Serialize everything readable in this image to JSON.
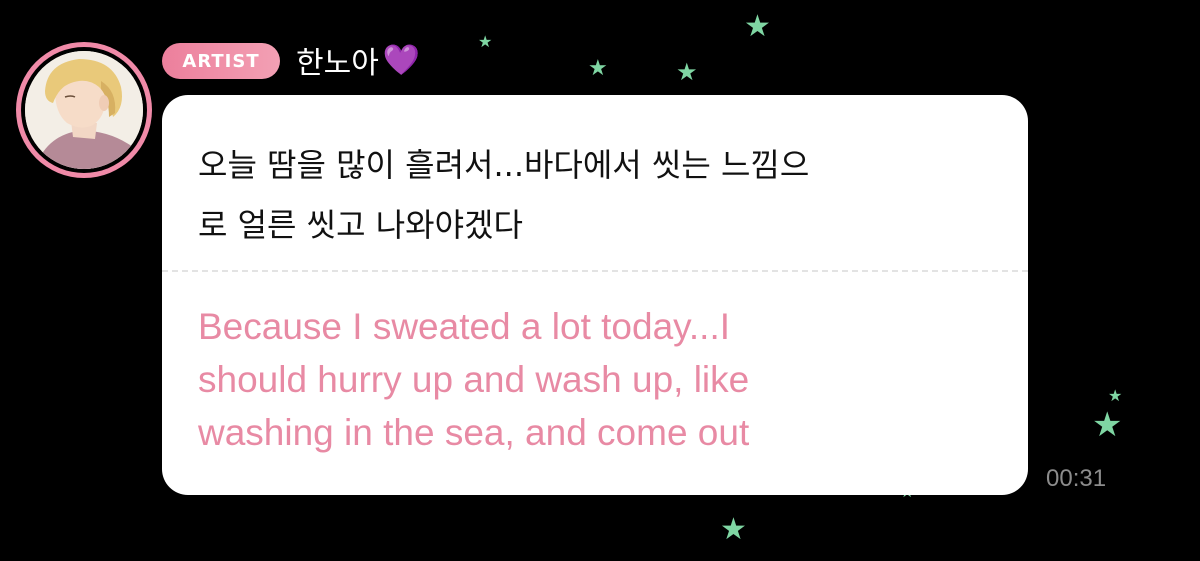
{
  "badge": {
    "label": "ARTIST"
  },
  "sender": {
    "name": "한노아",
    "heart": "💜"
  },
  "message": {
    "original_line1": "오늘 땀을 많이 흘려서...바다에서 씻는 느낌으",
    "original_line2": "로 얼른 씻고 나와야겠다",
    "translation_line1": "Because I sweated a lot today...I",
    "translation_line2": "should hurry up and wash up, like",
    "translation_line3": "washing in the sea, and come out"
  },
  "timestamp": "00:31",
  "colors": {
    "accent_pink": "#f08aa8",
    "translation_text": "#e88aa4",
    "star": "#7fd6a3",
    "background": "#000000"
  },
  "icons": {
    "avatar": "avatar-illustration",
    "heart": "purple-heart-icon",
    "decor": "star-icon"
  }
}
